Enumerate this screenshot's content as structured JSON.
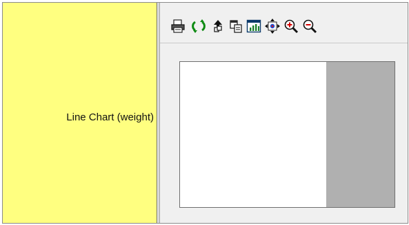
{
  "row": {
    "label": "Line Chart (weight)"
  },
  "toolbar": {
    "buttons": [
      {
        "icon": "printer-icon"
      },
      {
        "icon": "refresh-icon"
      },
      {
        "icon": "export-icon"
      },
      {
        "icon": "copy-icon"
      },
      {
        "icon": "chart-type-icon"
      },
      {
        "icon": "fit-to-window-icon"
      },
      {
        "icon": "zoom-in-icon"
      },
      {
        "icon": "zoom-out-icon"
      }
    ]
  },
  "colors": {
    "label_background": "#ffff80",
    "panel_background": "#f0f0f0",
    "plot_background": "#ffffff",
    "plot_side_background": "#b0b0b0"
  }
}
